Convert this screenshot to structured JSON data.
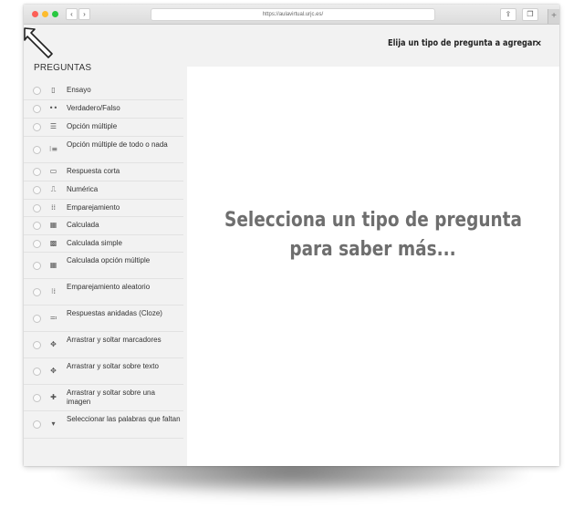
{
  "browser": {
    "url": "https://aulavirtual.urjc.es/",
    "back_glyph": "‹",
    "forward_glyph": "›",
    "share_glyph": "⇪",
    "tabs_glyph": "❐",
    "newtab_glyph": "+"
  },
  "modal": {
    "title": "Elija un tipo de pregunta a agregar",
    "close_glyph": "×"
  },
  "sidebar": {
    "title": "PREGUNTAS",
    "items": [
      {
        "label": "Ensayo",
        "icon": "essay-icon",
        "glyph": "▯"
      },
      {
        "label": "Verdadero/Falso",
        "icon": "true-false-icon",
        "glyph": "••"
      },
      {
        "label": "Opción múltiple",
        "icon": "multiple-choice-icon",
        "glyph": "☰"
      },
      {
        "label": "Opción múltiple de todo o nada",
        "icon": "all-or-nothing-icon",
        "glyph": "⁝≡"
      },
      {
        "label": "Respuesta corta",
        "icon": "short-answer-icon",
        "glyph": "▭"
      },
      {
        "label": "Numérica",
        "icon": "numerical-icon",
        "glyph": "⎍"
      },
      {
        "label": "Emparejamiento",
        "icon": "matching-icon",
        "glyph": "⁞⁞"
      },
      {
        "label": "Calculada",
        "icon": "calculated-icon",
        "glyph": "▦"
      },
      {
        "label": "Calculada simple",
        "icon": "calculated-simple-icon",
        "glyph": "▩"
      },
      {
        "label": "Calculada opción múltiple",
        "icon": "calculated-multichoice-icon",
        "glyph": "▦"
      },
      {
        "label": "Emparejamiento aleatorio",
        "icon": "random-matching-icon",
        "glyph": "⁝⁞"
      },
      {
        "label": "Respuestas anidadas (Cloze)",
        "icon": "cloze-icon",
        "glyph": "≕"
      },
      {
        "label": "Arrastrar y soltar marcadores",
        "icon": "drag-markers-icon",
        "glyph": "✥"
      },
      {
        "label": "Arrastrar y soltar sobre texto",
        "icon": "drag-text-icon",
        "glyph": "✥"
      },
      {
        "label": "Arrastrar y soltar sobre una imagen",
        "icon": "drag-image-icon",
        "glyph": "✚"
      },
      {
        "label": "Seleccionar las palabras que faltan",
        "icon": "select-missing-words-icon",
        "glyph": "▾"
      }
    ]
  },
  "main": {
    "message_line1": "Selecciona un tipo de pregunta",
    "message_line2": "para saber más..."
  },
  "colors": {
    "sidebar_bg": "#f2f2f2",
    "panel_bg": "#ffffff",
    "message_text": "#6e6e6e"
  }
}
